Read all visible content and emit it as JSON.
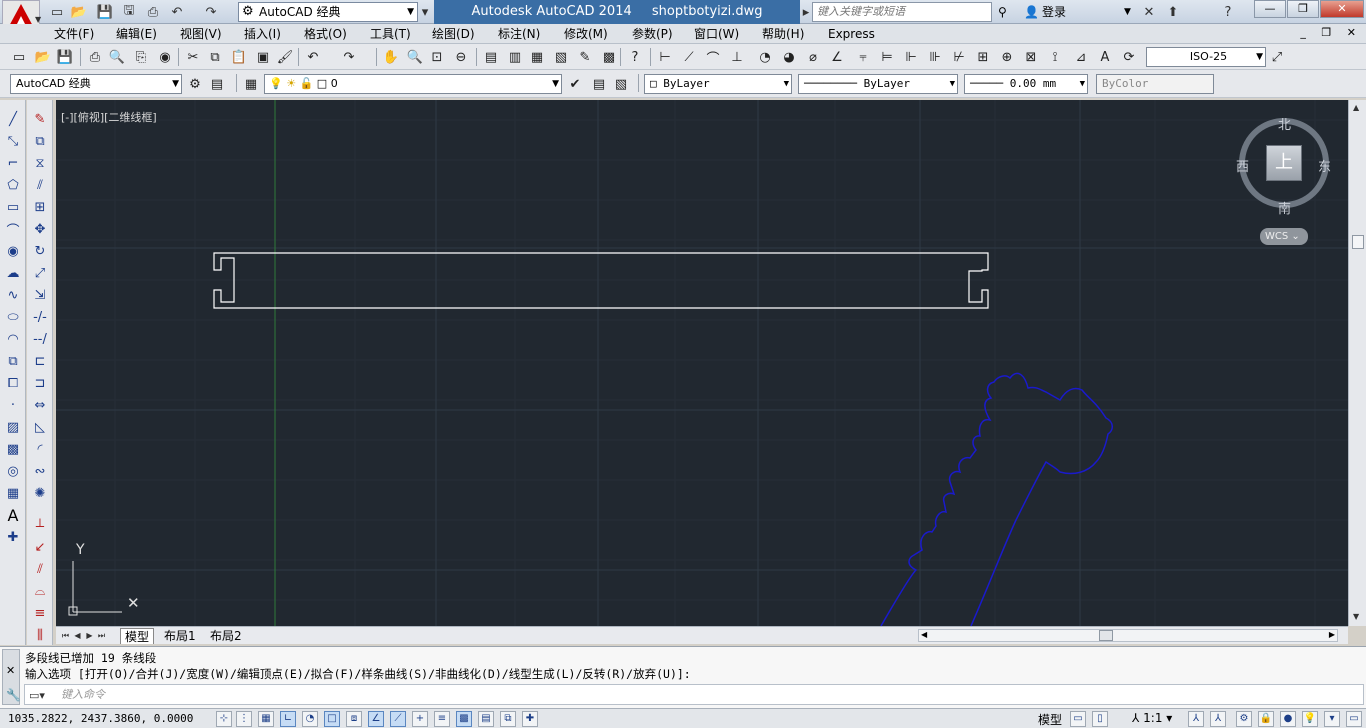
{
  "title_bar": {
    "workspace": "AutoCAD 经典",
    "app_name": "Autodesk AutoCAD 2014",
    "file_name": "shoptbotyizi.dwg",
    "search_placeholder": "键入关键字或短语",
    "login": "登录"
  },
  "menu": {
    "items": [
      "文件(F)",
      "编辑(E)",
      "视图(V)",
      "插入(I)",
      "格式(O)",
      "工具(T)",
      "绘图(D)",
      "标注(N)",
      "修改(M)",
      "参数(P)",
      "窗口(W)",
      "帮助(H)",
      "Express"
    ]
  },
  "toolbar": {
    "dim_style": "ISO-25",
    "workspace": "AutoCAD 经典",
    "layer": "0",
    "color": "ByLayer",
    "linetype": "ByLayer",
    "lineweight": "0.00 mm",
    "plot_style": "ByColor"
  },
  "viewport": {
    "label": "[-][俯视][二维线框]",
    "compass": {
      "north": "北",
      "south": "南",
      "east": "东",
      "west": "西",
      "top": "上"
    },
    "wcs": "WCS",
    "ucs_y": "Y"
  },
  "tabs": [
    "模型",
    "布局1",
    "布局2"
  ],
  "command": {
    "history": [
      "多段线已增加 19 条线段",
      "输入选项 [打开(O)/合并(J)/宽度(W)/编辑顶点(E)/拟合(F)/样条曲线(S)/非曲线化(D)/线型生成(L)/反转(R)/放弃(U)]:"
    ],
    "input_placeholder": "键入命令"
  },
  "status": {
    "coords": "1035.2822, 2437.3860, 0.0000",
    "model": "模型",
    "scale": "1:1"
  },
  "colors": {
    "canvas_bg": "#212830",
    "rect_line": "#ffffff",
    "curve_line": "#1a1acc",
    "grid_major": "#2c3540",
    "title_accent": "#3a6ea5"
  }
}
